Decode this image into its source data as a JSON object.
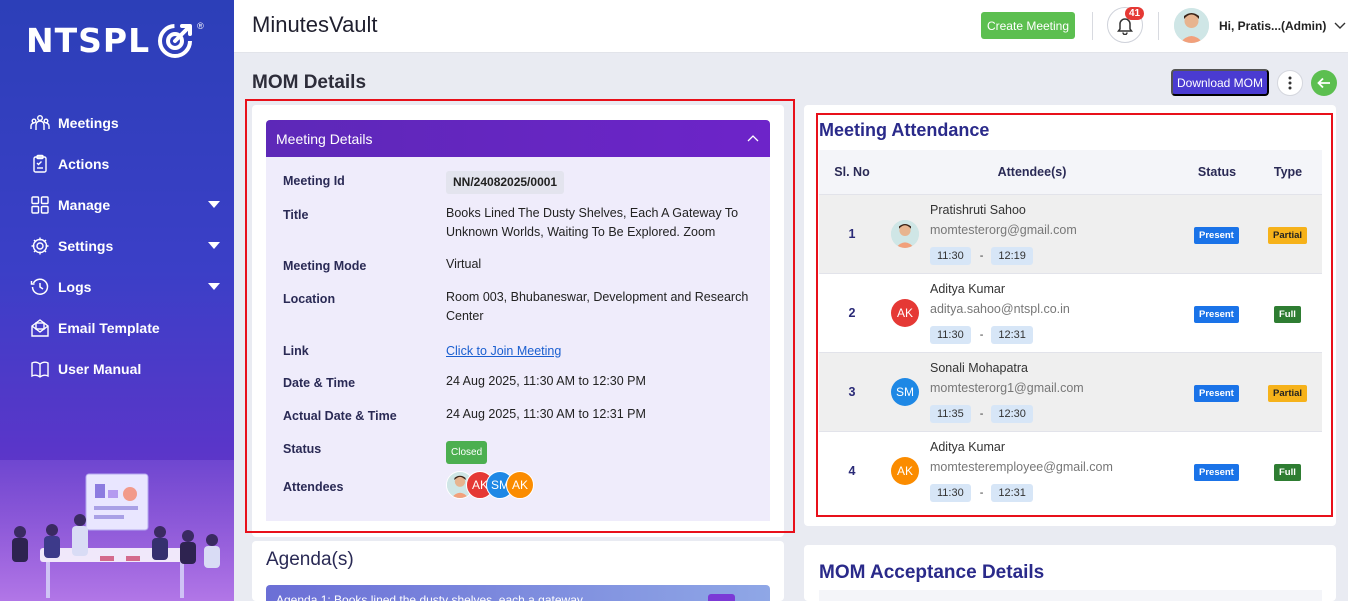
{
  "brand": {
    "name": "NTSPL",
    "reg": "®"
  },
  "sidebar": {
    "items": [
      {
        "label": "Meetings",
        "icon": "meetings-icon",
        "caret": false
      },
      {
        "label": "Actions",
        "icon": "actions-icon",
        "caret": false
      },
      {
        "label": "Manage",
        "icon": "manage-icon",
        "caret": true
      },
      {
        "label": "Settings",
        "icon": "gear-icon",
        "caret": true
      },
      {
        "label": "Logs",
        "icon": "history-icon",
        "caret": true
      },
      {
        "label": "Email Template",
        "icon": "email-icon",
        "caret": false
      },
      {
        "label": "User Manual",
        "icon": "book-icon",
        "caret": false
      }
    ]
  },
  "header": {
    "app_title": "MinutesVault",
    "create_label": "Create Meeting",
    "notification_count": "41",
    "user_label": "Hi, Pratis...(Admin)"
  },
  "page": {
    "title": "MOM Details",
    "download_label": "Download MOM"
  },
  "meeting_details": {
    "header": "Meeting Details",
    "fields": {
      "id_label": "Meeting Id",
      "id_value": "NN/24082025/0001",
      "title_label": "Title",
      "title_value": "Books Lined The Dusty Shelves, Each A Gateway To Unknown Worlds, Waiting To Be Explored. Zoom",
      "mode_label": "Meeting Mode",
      "mode_value": "Virtual",
      "location_label": "Location",
      "location_value": "Room 003, Bhubaneswar, Development and Research Center",
      "link_label": "Link",
      "link_value": "Click to Join Meeting",
      "datetime_label": "Date & Time",
      "datetime_value": "24 Aug 2025, 11:30 AM to 12:30 PM",
      "actual_label": "Actual Date & Time",
      "actual_value": "24 Aug 2025, 11:30 AM to 12:31 PM",
      "status_label": "Status",
      "status_value": "Closed",
      "attendees_label": "Attendees"
    },
    "attendee_initials": [
      "AK",
      "SM",
      "AK"
    ]
  },
  "agenda": {
    "title": "Agenda(s)",
    "first_item": "Agenda 1: Books lined the dusty shelves, each a gateway"
  },
  "attendance": {
    "title": "Meeting Attendance",
    "columns": {
      "sl": "Sl. No",
      "attendee": "Attendee(s)",
      "status": "Status",
      "type": "Type"
    },
    "rows": [
      {
        "sl": "1",
        "name": "Pratishruti Sahoo",
        "email": "momtesterorg@gmail.com",
        "in": "11:30",
        "out": "12:19",
        "status": "Present",
        "type": "Partial",
        "initials": "",
        "color": "#cfe6e6"
      },
      {
        "sl": "2",
        "name": "Aditya Kumar",
        "email": "aditya.sahoo@ntspl.co.in",
        "in": "11:30",
        "out": "12:31",
        "status": "Present",
        "type": "Full",
        "initials": "AK",
        "color": "#e53935"
      },
      {
        "sl": "3",
        "name": "Sonali Mohapatra",
        "email": "momtesterorg1@gmail.com",
        "in": "11:35",
        "out": "12:30",
        "status": "Present",
        "type": "Partial",
        "initials": "SM",
        "color": "#1e88e5"
      },
      {
        "sl": "4",
        "name": "Aditya Kumar",
        "email": "momtesteremployee@gmail.com",
        "in": "11:30",
        "out": "12:31",
        "status": "Present",
        "type": "Full",
        "initials": "AK",
        "color": "#fb8c00"
      }
    ],
    "time_separator": "-"
  },
  "acceptance": {
    "title": "MOM Acceptance Details"
  },
  "colors": {
    "accent": "#5d28b8",
    "create_green": "#5cbf50",
    "download": "#4a3bd1",
    "highlight": "#e8101a"
  }
}
